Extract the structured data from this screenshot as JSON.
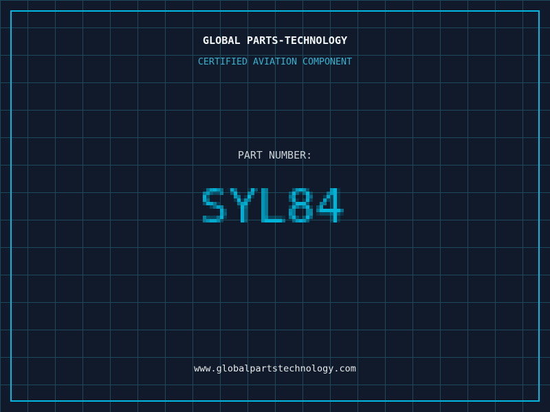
{
  "header": {
    "title": "GLOBAL PARTS-TECHNOLOGY",
    "subtitle": "CERTIFIED AVIATION COMPONENT"
  },
  "part": {
    "label": "PART NUMBER:",
    "number": "SYL84"
  },
  "footer": {
    "url": "www.globalpartstechnology.com"
  },
  "colors": {
    "background": "#101a2a",
    "grid_line": "#1d4a5a",
    "frame": "#00b8e0",
    "title": "#f2f5f5",
    "subtitle": "#35b2d2",
    "part_label": "#ccd2d8",
    "part_number": "#00b4d8",
    "url": "#e6eaec"
  }
}
